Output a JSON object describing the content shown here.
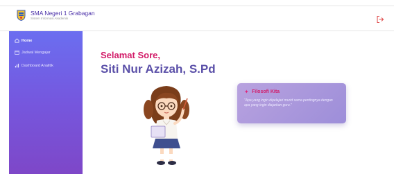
{
  "header": {
    "school_name": "SMA Negeri 1 Grabagan",
    "subtitle": "Sistem Informasi Akademik",
    "logout_icon": "logout-icon"
  },
  "sidebar": {
    "items": [
      {
        "label": "Home",
        "icon": "home-icon",
        "active": true
      },
      {
        "label": "Jadwal Mengajar",
        "icon": "calendar-icon",
        "active": false
      },
      {
        "label": "Dashboard Analitik",
        "icon": "bar-chart-icon",
        "active": false
      }
    ]
  },
  "main": {
    "greeting": "Selamat Sore,",
    "user_name": "Siti Nur Azizah, S.Pd",
    "philosophy_card": {
      "icon": "sparkle-icon",
      "title": "Filosofi Kita",
      "quote": "\"Apa yang ingin dipelajari murid sama pentingnya dengan apa yang ingin diajarkan guru.\""
    }
  },
  "colors": {
    "sidebar_top": "#6b6ef0",
    "sidebar_bottom": "#7e47c8",
    "greeting": "#d21b68",
    "name": "#5a4fa8",
    "card_bg": "#b8a2df"
  }
}
